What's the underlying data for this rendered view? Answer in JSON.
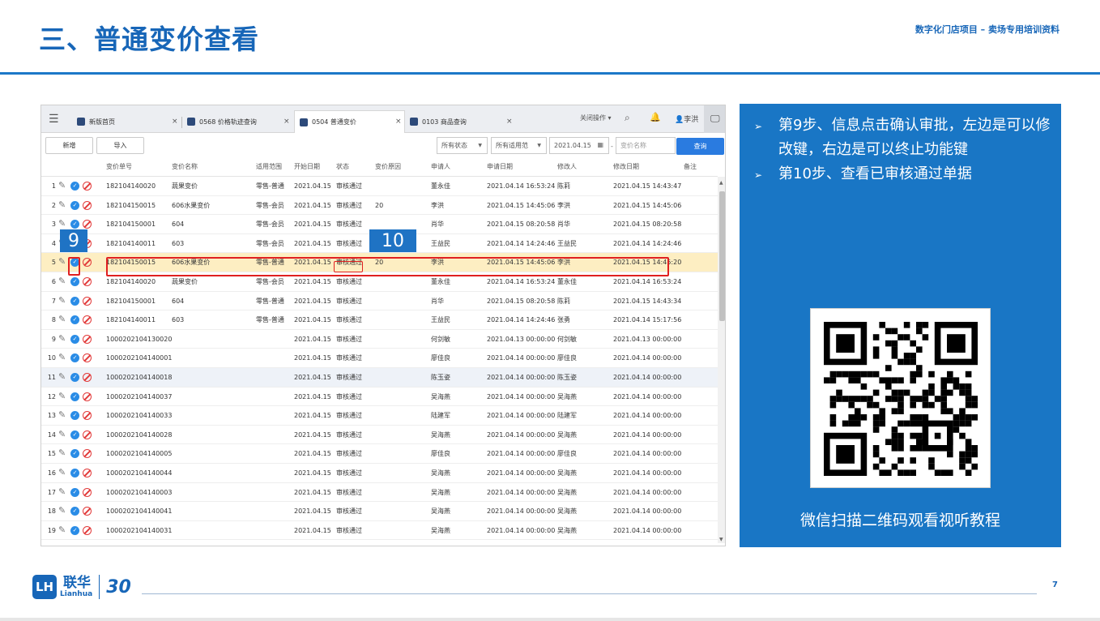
{
  "slide": {
    "title": "三、普通变价查看",
    "subtitle": "数字化门店项目 – 卖场专用培训资料",
    "page_number": "7",
    "logo_cn": "联华",
    "logo_en": "Lianhua",
    "logo_anniversary": "30"
  },
  "app": {
    "tabs": [
      {
        "label": "新版首页",
        "active": false
      },
      {
        "label": "0568 价格轨迹查询",
        "active": false
      },
      {
        "label": "0504 普通变价",
        "active": true
      },
      {
        "label": "0103 商品查询",
        "active": false
      }
    ],
    "topbar": {
      "close_ops_label": "关闭操作",
      "user_name": "李洪"
    },
    "toolbar": {
      "new_label": "新增",
      "import_label": "导入",
      "status_filter": "所有状态",
      "scope_filter": "所有适用范",
      "date_value": "2021.04.15",
      "name_placeholder": "变价名称",
      "query_label": "查询"
    },
    "columns": [
      "变价单号",
      "变价名称",
      "适用范围",
      "开始日期",
      "状态",
      "变价原因",
      "申请人",
      "申请日期",
      "修改人",
      "修改日期",
      "备注"
    ],
    "rows": [
      {
        "n": "1",
        "id": "182104140020",
        "name": "蔬果变价",
        "scope": "零售-普通",
        "start": "2021.04.15",
        "status": "审核通过",
        "reason": "",
        "applicant": "董永佳",
        "apply_date": "2021.04.14 16:53:24",
        "modifier": "陈莉",
        "mod_date": "2021.04.15 14:43:47"
      },
      {
        "n": "2",
        "id": "182104150015",
        "name": "606水果变价",
        "scope": "零售-会员",
        "start": "2021.04.15",
        "status": "审核通过",
        "reason": "20",
        "applicant": "李洪",
        "apply_date": "2021.04.15 14:45:06",
        "modifier": "李洪",
        "mod_date": "2021.04.15 14:45:06"
      },
      {
        "n": "3",
        "id": "182104150001",
        "name": "604",
        "scope": "零售-会员",
        "start": "2021.04.15",
        "status": "审核通过",
        "reason": "",
        "applicant": "肖华",
        "apply_date": "2021.04.15 08:20:58",
        "modifier": "肖华",
        "mod_date": "2021.04.15 08:20:58"
      },
      {
        "n": "4",
        "id": "182104140011",
        "name": "603",
        "scope": "零售-会员",
        "start": "2021.04.15",
        "status": "审核通过",
        "reason": "",
        "applicant": "王益民",
        "apply_date": "2021.04.14 14:24:46",
        "modifier": "王益民",
        "mod_date": "2021.04.14 14:24:46"
      },
      {
        "n": "5",
        "id": "182104150015",
        "name": "606水果变价",
        "scope": "零售-普通",
        "start": "2021.04.15",
        "status": "审核通过",
        "reason": "20",
        "applicant": "李洪",
        "apply_date": "2021.04.15 14:45:06",
        "modifier": "李洪",
        "mod_date": "2021.04.15 14:45:20"
      },
      {
        "n": "6",
        "id": "182104140020",
        "name": "蔬果变价",
        "scope": "零售-会员",
        "start": "2021.04.15",
        "status": "审核通过",
        "reason": "",
        "applicant": "董永佳",
        "apply_date": "2021.04.14 16:53:24",
        "modifier": "董永佳",
        "mod_date": "2021.04.14 16:53:24"
      },
      {
        "n": "7",
        "id": "182104150001",
        "name": "604",
        "scope": "零售-普通",
        "start": "2021.04.15",
        "status": "审核通过",
        "reason": "",
        "applicant": "肖华",
        "apply_date": "2021.04.15 08:20:58",
        "modifier": "陈莉",
        "mod_date": "2021.04.15 14:43:34"
      },
      {
        "n": "8",
        "id": "182104140011",
        "name": "603",
        "scope": "零售-普通",
        "start": "2021.04.15",
        "status": "审核通过",
        "reason": "",
        "applicant": "王益民",
        "apply_date": "2021.04.14 14:24:46",
        "modifier": "张勇",
        "mod_date": "2021.04.14 15:17:56"
      },
      {
        "n": "9",
        "id": "1000202104130020",
        "name": "",
        "scope": "",
        "start": "2021.04.15",
        "status": "审核通过",
        "reason": "",
        "applicant": "何剑敏",
        "apply_date": "2021.04.13 00:00:00",
        "modifier": "何剑敏",
        "mod_date": "2021.04.13 00:00:00"
      },
      {
        "n": "10",
        "id": "1000202104140001",
        "name": "",
        "scope": "",
        "start": "2021.04.15",
        "status": "审核通过",
        "reason": "",
        "applicant": "廖佳良",
        "apply_date": "2021.04.14 00:00:00",
        "modifier": "廖佳良",
        "mod_date": "2021.04.14 00:00:00"
      },
      {
        "n": "11",
        "id": "1000202104140018",
        "name": "",
        "scope": "",
        "start": "2021.04.15",
        "status": "审核通过",
        "reason": "",
        "applicant": "陈玉姿",
        "apply_date": "2021.04.14 00:00:00",
        "modifier": "陈玉姿",
        "mod_date": "2021.04.14 00:00:00"
      },
      {
        "n": "12",
        "id": "1000202104140037",
        "name": "",
        "scope": "",
        "start": "2021.04.15",
        "status": "审核通过",
        "reason": "",
        "applicant": "吴海燕",
        "apply_date": "2021.04.14 00:00:00",
        "modifier": "吴海燕",
        "mod_date": "2021.04.14 00:00:00"
      },
      {
        "n": "13",
        "id": "1000202104140033",
        "name": "",
        "scope": "",
        "start": "2021.04.15",
        "status": "审核通过",
        "reason": "",
        "applicant": "陆建军",
        "apply_date": "2021.04.14 00:00:00",
        "modifier": "陆建军",
        "mod_date": "2021.04.14 00:00:00"
      },
      {
        "n": "14",
        "id": "1000202104140028",
        "name": "",
        "scope": "",
        "start": "2021.04.15",
        "status": "审核通过",
        "reason": "",
        "applicant": "吴海燕",
        "apply_date": "2021.04.14 00:00:00",
        "modifier": "吴海燕",
        "mod_date": "2021.04.14 00:00:00"
      },
      {
        "n": "15",
        "id": "1000202104140005",
        "name": "",
        "scope": "",
        "start": "2021.04.15",
        "status": "审核通过",
        "reason": "",
        "applicant": "廖佳良",
        "apply_date": "2021.04.14 00:00:00",
        "modifier": "廖佳良",
        "mod_date": "2021.04.14 00:00:00"
      },
      {
        "n": "16",
        "id": "1000202104140044",
        "name": "",
        "scope": "",
        "start": "2021.04.15",
        "status": "审核通过",
        "reason": "",
        "applicant": "吴海燕",
        "apply_date": "2021.04.14 00:00:00",
        "modifier": "吴海燕",
        "mod_date": "2021.04.14 00:00:00"
      },
      {
        "n": "17",
        "id": "1000202104140003",
        "name": "",
        "scope": "",
        "start": "2021.04.15",
        "status": "审核通过",
        "reason": "",
        "applicant": "吴海燕",
        "apply_date": "2021.04.14 00:00:00",
        "modifier": "吴海燕",
        "mod_date": "2021.04.14 00:00:00"
      },
      {
        "n": "18",
        "id": "1000202104140041",
        "name": "",
        "scope": "",
        "start": "2021.04.15",
        "status": "审核通过",
        "reason": "",
        "applicant": "吴海燕",
        "apply_date": "2021.04.14 00:00:00",
        "modifier": "吴海燕",
        "mod_date": "2021.04.14 00:00:00"
      },
      {
        "n": "19",
        "id": "1000202104140031",
        "name": "",
        "scope": "",
        "start": "2021.04.15",
        "status": "审核通过",
        "reason": "",
        "applicant": "吴海燕",
        "apply_date": "2021.04.14 00:00:00",
        "modifier": "吴海燕",
        "mod_date": "2021.04.14 00:00:00"
      }
    ],
    "selected_row": 5,
    "callout_9": "9",
    "callout_10": "10"
  },
  "panel": {
    "bullets": [
      "第9步、信息点击确认审批，左边是可以修改键，右边是可以终止功能键",
      "第10步、查看已审核通过单据"
    ],
    "qr_caption": "微信扫描二维码观看视听教程"
  },
  "colors": {
    "brand_blue": "#1766b8",
    "panel_blue": "#1976c5",
    "highlight_red": "#e02020",
    "selected_row": "#fdeec2"
  }
}
